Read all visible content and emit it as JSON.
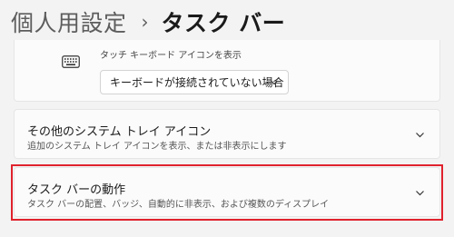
{
  "header": {
    "breadcrumb_parent": "個人用設定",
    "separator": "›",
    "breadcrumb_current": "タスク バー"
  },
  "touch_keyboard": {
    "label": "タッチ キーボード アイコンを表示",
    "icon": "keyboard-icon",
    "dropdown_value": "キーボードが接続されていない場合"
  },
  "system_tray": {
    "title": "その他のシステム トレイ アイコン",
    "subtitle": "追加のシステム トレイ アイコンを表示、または非表示にします"
  },
  "behaviors": {
    "title": "タスク バーの動作",
    "subtitle": "タスク バーの配置、バッジ、自動的に非表示、および複数のディスプレイ"
  },
  "colors": {
    "highlight": "#e0222d",
    "background": "#f3f3f3",
    "card": "#fbfbfb"
  }
}
